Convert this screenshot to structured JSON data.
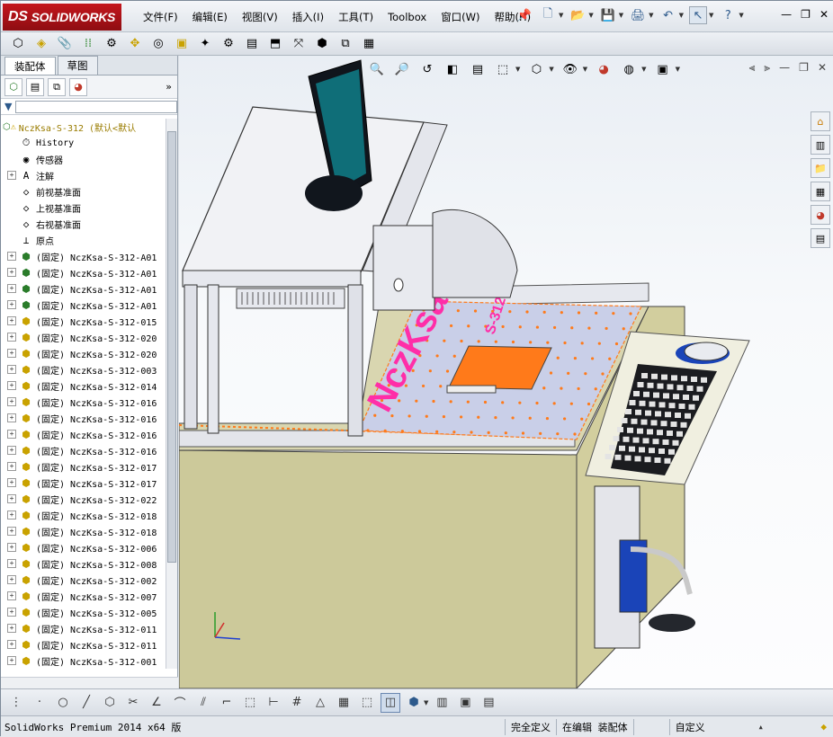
{
  "app": {
    "brand": "SOLIDWORKS",
    "brand_prefix": "DS",
    "colors": {
      "brand": "#c4161c",
      "accent": "#2d5a8c"
    }
  },
  "menu": [
    "文件(F)",
    "编辑(E)",
    "视图(V)",
    "插入(I)",
    "工具(T)",
    "Toolbox",
    "窗口(W)",
    "帮助(H)"
  ],
  "panel": {
    "tabs": [
      "装配体",
      "草图"
    ],
    "active_tab": "装配体",
    "root": "NczKsa-S-312  (默认<默认",
    "features": [
      {
        "label": "History",
        "icon": "history-icon",
        "expand": false
      },
      {
        "label": "传感器",
        "icon": "sensor-icon",
        "expand": false
      },
      {
        "label": "注解",
        "icon": "annotation-icon",
        "expand": true
      },
      {
        "label": "前视基准面",
        "icon": "plane-icon",
        "expand": false
      },
      {
        "label": "上视基准面",
        "icon": "plane-icon",
        "expand": false
      },
      {
        "label": "右视基准面",
        "icon": "plane-icon",
        "expand": false
      },
      {
        "label": "原点",
        "icon": "origin-icon",
        "expand": false
      }
    ],
    "components": [
      "(固定) NczKsa-S-312-A01",
      "(固定) NczKsa-S-312-A01",
      "(固定) NczKsa-S-312-A01",
      "(固定) NczKsa-S-312-A01",
      "(固定) NczKsa-S-312-015",
      "(固定) NczKsa-S-312-020",
      "(固定) NczKsa-S-312-020",
      "(固定) NczKsa-S-312-003",
      "(固定) NczKsa-S-312-014",
      "(固定) NczKsa-S-312-016",
      "(固定) NczKsa-S-312-016",
      "(固定) NczKsa-S-312-016",
      "(固定) NczKsa-S-312-016",
      "(固定) NczKsa-S-312-017",
      "(固定) NczKsa-S-312-017",
      "(固定) NczKsa-S-312-022",
      "(固定) NczKsa-S-312-018",
      "(固定) NczKsa-S-312-018",
      "(固定) NczKsa-S-312-006",
      "(固定) NczKsa-S-312-008",
      "(固定) NczKsa-S-312-002",
      "(固定) NczKsa-S-312-007",
      "(固定) NczKsa-S-312-005",
      "(固定) NczKsa-S-312-011",
      "(固定) NczKsa-S-312-011",
      "(固定) NczKsa-S-312-001"
    ]
  },
  "model": {
    "label_big": "NczKsa.",
    "label_small": "S-312",
    "colors": {
      "desk": "#d6d3a0",
      "plate": "#c9cfe8",
      "marker": "#ff2ea8",
      "part": "#ff7a1a",
      "frame": "#e6e8ee"
    }
  },
  "status": {
    "product": "SolidWorks Premium 2014 x64 版",
    "fully_defined": "完全定义",
    "editing": "在编辑 装配体",
    "units": "自定义"
  }
}
